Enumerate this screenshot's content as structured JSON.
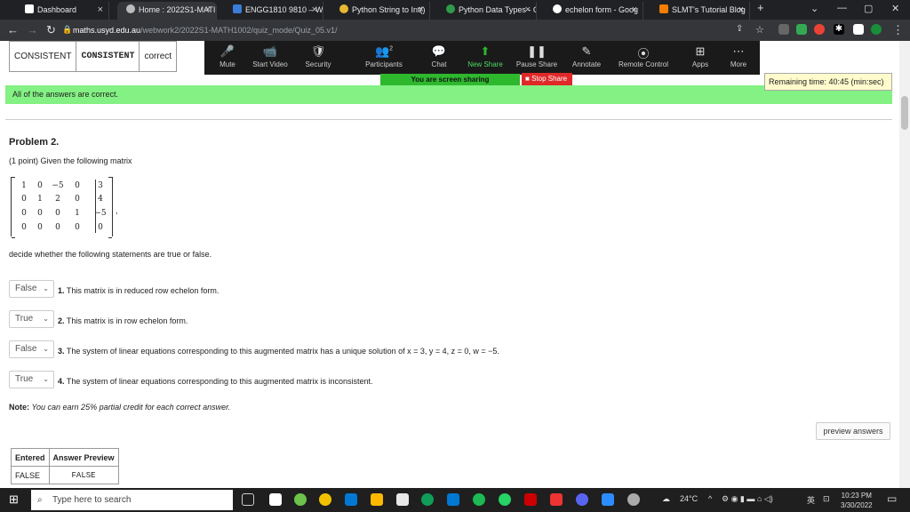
{
  "tabs": [
    {
      "title": "Dashboard",
      "active": false
    },
    {
      "title": "Home : 2022S1-MATI",
      "active": true
    },
    {
      "title": "ENGG1810 9810 – W",
      "active": false
    },
    {
      "title": "Python String to Int()",
      "active": false
    },
    {
      "title": "Python Data Types - C",
      "active": false
    },
    {
      "title": "echelon form - Goog",
      "active": false
    },
    {
      "title": "SLMT's Tutorial Blog",
      "active": false
    }
  ],
  "address": {
    "host": "maths.usyd.edu.au",
    "path": "/webwork2/2022S1-MATH1002/quiz_mode/Quiz_05.v1/"
  },
  "zoom": {
    "items": [
      {
        "label": "Mute",
        "glyph": "🎤"
      },
      {
        "label": "Start Video",
        "glyph": "📹"
      },
      {
        "label": "Security",
        "glyph": "🛡"
      },
      {
        "label": "Participants",
        "glyph": "👥"
      },
      {
        "label": "Chat",
        "glyph": "💬"
      },
      {
        "label": "New Share",
        "glyph": "⬆"
      },
      {
        "label": "Pause Share",
        "glyph": "❚❚"
      },
      {
        "label": "Annotate",
        "glyph": "✎"
      },
      {
        "label": "Remote Control",
        "glyph": "⦿"
      },
      {
        "label": "Apps",
        "glyph": "⊞"
      },
      {
        "label": "More",
        "glyph": "⋯"
      }
    ],
    "participants_count": "2",
    "sharing_text": "You are screen sharing",
    "stop_share": "Stop Share"
  },
  "remaining_time": "Remaining time: 40:45 (min:sec)",
  "top_table": [
    "CONSISTENT",
    "CONSISTENT",
    "correct"
  ],
  "all_correct": "All of the answers are correct.",
  "problem": {
    "title": "Problem 2.",
    "desc": "(1 point) Given the following matrix",
    "matrix": [
      [
        "1",
        "0",
        "−5",
        "0",
        "3"
      ],
      [
        "0",
        "1",
        "2",
        "0",
        "4"
      ],
      [
        "0",
        "0",
        "0",
        "1",
        "−5"
      ],
      [
        "0",
        "0",
        "0",
        "0",
        "0"
      ]
    ],
    "comma": ",",
    "instruction": "decide whether the following statements are true or false.",
    "statements": [
      {
        "selected": "False",
        "num": "1.",
        "text": "This matrix is in reduced row echelon form."
      },
      {
        "selected": "True",
        "num": "2.",
        "text": "This matrix is in row echelon form."
      },
      {
        "selected": "False",
        "num": "3.",
        "text": "The system of linear equations corresponding to this augmented matrix has a unique solution of x = 3, y = 4, z = 0, w = −5."
      },
      {
        "selected": "True",
        "num": "4.",
        "text": "The system of linear equations corresponding to this augmented matrix is inconsistent."
      }
    ],
    "note_label": "Note:",
    "note_text": "You can earn 25% partial credit for each correct answer."
  },
  "preview_button": "preview answers",
  "answer_table": {
    "headers": [
      "Entered",
      "Answer Preview"
    ],
    "row": [
      "FALSE",
      "FALSE"
    ]
  },
  "taskbar": {
    "search": "Type here to search",
    "temp": "24°C",
    "time": "10:23 PM",
    "date": "3/30/2022",
    "lang": "英"
  }
}
